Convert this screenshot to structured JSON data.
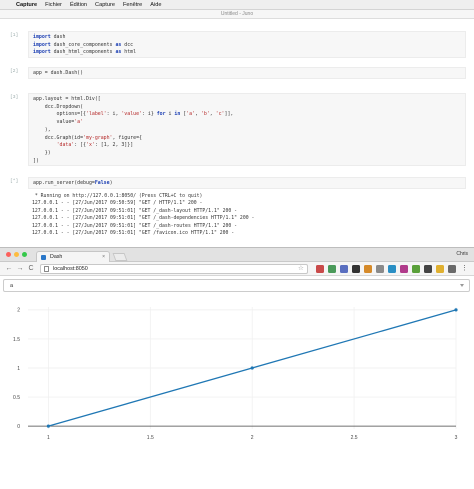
{
  "menubar": {
    "apple": "",
    "items": [
      "Capture",
      "Fichier",
      "Édition",
      "Capture",
      "Fenêtre",
      "Aide"
    ]
  },
  "notebook": {
    "window_title": "Untitled - Juno",
    "cells": [
      {
        "prompt": "[1]",
        "lines": [
          "import dash",
          "import dash_core_components as dcc",
          "import dash_html_components as html"
        ]
      },
      {
        "prompt": "[2]",
        "lines": [
          "app = dash.Dash()"
        ]
      },
      {
        "prompt": "[3]",
        "lines": [
          "app.layout = html.Div([",
          "    dcc.Dropdown(",
          "        options=[{'label': i, 'value': i} for i in ['a', 'b', 'c']],",
          "        value='a'",
          "    ),",
          "    dcc.Graph(id='my-graph', figure={",
          "        'data': [{'x': [1, 2, 3]}]",
          "    })",
          "])"
        ]
      },
      {
        "prompt": "[*]",
        "lines": [
          "app.run_server(debug=False)"
        ]
      }
    ],
    "output_lines": [
      " * Running on http://127.0.0.1:8050/ (Press CTRL+C to quit)",
      "127.0.0.1 - - [27/Jun/2017 09:50:59] \"GET / HTTP/1.1\" 200 -",
      "127.0.0.1 - - [27/Jun/2017 09:51:01] \"GET /_dash-layout HTTP/1.1\" 200 -",
      "127.0.0.1 - - [27/Jun/2017 09:51:01] \"GET /_dash-dependencies HTTP/1.1\" 200 -",
      "127.0.0.1 - - [27/Jun/2017 09:51:01] \"GET /_dash-routes HTTP/1.1\" 200 -",
      "127.0.0.1 - - [27/Jun/2017 09:51:01] \"GET /favicon.ico HTTP/1.1\" 200 -"
    ]
  },
  "browser": {
    "tab_title": "Dash",
    "tab_close": "×",
    "profile": "Chris",
    "url": "localhost:8050",
    "back": "←",
    "forward": "→",
    "reload": "C",
    "star": "☆",
    "menu": "⋮",
    "colors": {
      "accent": "#1f77b4",
      "favicon": "#2a77c9"
    }
  },
  "dropdown": {
    "value": "a"
  },
  "chart_data": {
    "type": "line",
    "series": [
      {
        "x": [
          1,
          2,
          3
        ],
        "y": [
          0,
          1,
          2
        ]
      }
    ],
    "xlim": [
      0.9,
      3.0
    ],
    "ylim": [
      -0.05,
      2.05
    ],
    "xticks": [
      1,
      1.5,
      2,
      2.5,
      3
    ],
    "xtick_labels": [
      "1",
      "1.5",
      "2",
      "2.5",
      "3"
    ],
    "yticks": [
      0,
      0.5,
      1,
      1.5,
      2
    ],
    "ytick_labels": [
      "0",
      "0.5",
      "1",
      "1.5",
      "2"
    ],
    "color": "#1f77b4",
    "grid": true,
    "markers": true
  }
}
